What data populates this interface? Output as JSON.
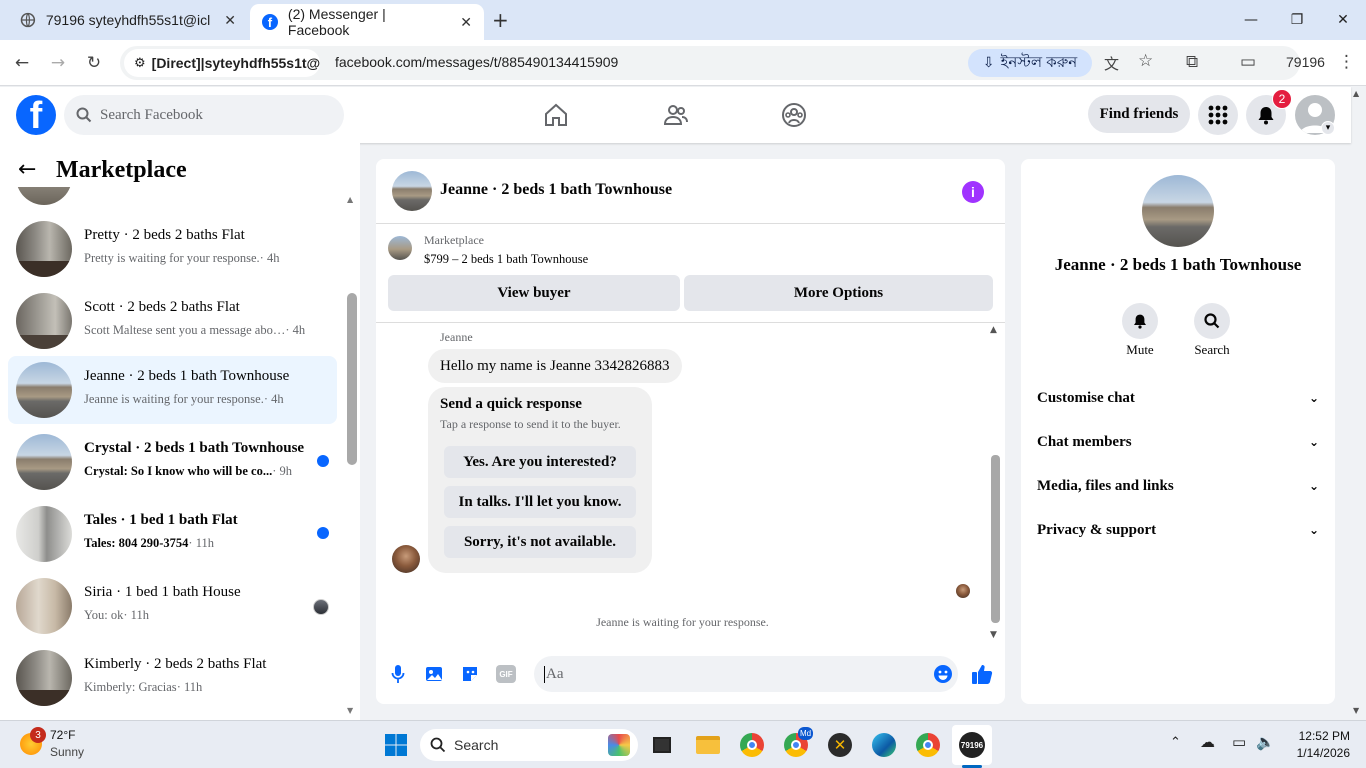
{
  "browser": {
    "tabs": [
      {
        "title": "79196 syteyhdfh55s1t@icl",
        "active": false
      },
      {
        "title": "(2) Messenger | Facebook",
        "active": true
      }
    ],
    "new_tab": "+",
    "address_chip": "[Direct]|syteyhdfh55s1t@...",
    "url": "facebook.com/messages/t/885490134415909",
    "install_label": "ইনস্টল করুন",
    "profile_label": "79196"
  },
  "fb": {
    "logo_letter": "f",
    "search_placeholder": "Search Facebook",
    "find_friends": "Find friends",
    "notifications_count": "2"
  },
  "sidebar": {
    "title": "Marketplace",
    "conversations": [
      {
        "name": "Pretty · 2 beds 2 baths Flat",
        "preview": "Pretty is waiting for your response.",
        "time": " · 4h",
        "unread": false,
        "selected": false
      },
      {
        "name": "Scott · 2 beds 2 baths Flat",
        "preview": "Scott Maltese sent you a message abo…",
        "time": " · 4h",
        "unread": false,
        "selected": false
      },
      {
        "name": "Jeanne · 2 beds 1 bath Townhouse",
        "preview": "Jeanne is waiting for your response.",
        "time": " · 4h",
        "unread": false,
        "selected": true
      },
      {
        "name": "Crystal · 2 beds 1 bath Townhouse",
        "preview": "Crystal: So I know who will be co...",
        "time": " · 9h",
        "unread": true,
        "selected": false
      },
      {
        "name": "Tales · 1 bed 1 bath Flat",
        "preview": "Tales: 804 290-3754",
        "time": " · 11h",
        "unread": true,
        "selected": false
      },
      {
        "name": "Siria · 1 bed 1 bath House",
        "preview": "You: ok",
        "time": " · 11h",
        "unread": false,
        "selected": false
      },
      {
        "name": "Kimberly · 2 beds 2 baths Flat",
        "preview": "Kimberly: Gracias",
        "time": " · 11h",
        "unread": false,
        "selected": false
      }
    ]
  },
  "chat": {
    "title": "Jeanne · 2 beds 1 bath Townhouse",
    "marketplace_label": "Marketplace",
    "listing": "$799 – 2 beds 1 bath Townhouse",
    "view_buyer": "View buyer",
    "more_options": "More Options",
    "sender": "Jeanne",
    "message": "Hello my name is Jeanne 3342826883",
    "quick_title": "Send a quick response",
    "quick_sub": "Tap a response to send it to the buyer.",
    "quick_responses": [
      "Yes. Are you interested?",
      "In talks. I'll let you know.",
      "Sorry, it's not available."
    ],
    "waiting": "Jeanne is waiting for your response.",
    "composer_placeholder": "Aa",
    "gif_label": "GIF"
  },
  "info": {
    "name": "Jeanne · 2 beds 1 bath Townhouse",
    "mute": "Mute",
    "search": "Search",
    "sections": [
      "Customise chat",
      "Chat members",
      "Media, files and links",
      "Privacy & support"
    ]
  },
  "taskbar": {
    "weather_temp": "72°F",
    "weather_desc": "Sunny",
    "weather_badge": "3",
    "search_label": "Search",
    "time": "12:52 PM",
    "date": "1/14/2026",
    "app_badge": "Md",
    "active_app_label": "79196"
  },
  "colors": {
    "fb_blue": "#0866ff",
    "accent_purple": "#a033ff",
    "unread_dot": "#0866ff",
    "badge_red": "#e41e3f"
  }
}
